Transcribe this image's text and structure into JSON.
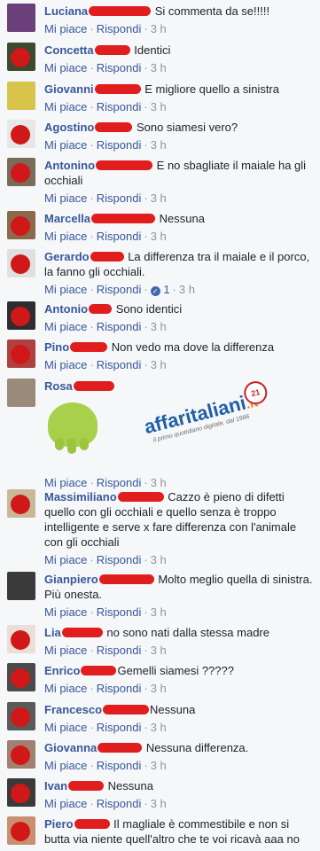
{
  "actions": {
    "like": "Mi piace",
    "reply": "Rispondi",
    "separator": "·"
  },
  "watermark": {
    "brand": "affaritaliani",
    "tld": ".it",
    "subtitle": "il primo quotidiano digitale, dal 1996",
    "badge": "21"
  },
  "comments": [
    {
      "name": "Luciana",
      "text": "Si commenta da se!!!!!",
      "time": "3 h"
    },
    {
      "name": "Concetta",
      "text": "Identici",
      "time": "3 h"
    },
    {
      "name": "Giovanni",
      "text": "E migliore quello a sinistra",
      "time": "3 h"
    },
    {
      "name": "Agostino",
      "text": "Sono siamesi vero?",
      "time": "3 h"
    },
    {
      "name": "Antonino",
      "text": "E no sbagliate il maiale ha gli occhiali",
      "time": "3 h"
    },
    {
      "name": "Marcella",
      "text": "Nessuna",
      "time": "3 h"
    },
    {
      "name": "Gerardo",
      "text": "La differenza tra il maiale e il porco, la fanno gli occhiali.",
      "time": "3 h",
      "likes": "1"
    },
    {
      "name": "Antonio",
      "text": "Sono identici",
      "time": "3 h"
    },
    {
      "name": "Pino",
      "text": "Non vedo ma dove la differenza",
      "time": "3 h"
    },
    {
      "name": "Rosa",
      "text": "",
      "time": "3 h"
    },
    {
      "name": "Massimiliano",
      "text": "Cazzo è pieno di difetti quello con gli occhiali e quello senza è troppo intelligente e serve x fare differenza con l'animale con gli occhiali",
      "time": "3 h"
    },
    {
      "name": "Gianpiero",
      "text": "Molto meglio quella di sinistra. Più onesta.",
      "time": "3 h"
    },
    {
      "name": "Lia",
      "text": "no sono nati dalla stessa madre",
      "time": "3 h"
    },
    {
      "name": "Enrico",
      "text": "Gemelli siamesi ?????",
      "time": "3 h"
    },
    {
      "name": "Francesco",
      "text": "Nessuna",
      "time": "3 h"
    },
    {
      "name": "Giovanna",
      "text": "Nessuna differenza.",
      "time": "3 h"
    },
    {
      "name": "Ivan",
      "text": "Nessuna",
      "time": "3 h"
    },
    {
      "name": "Piero",
      "text": "Il magliale è commestibile e non si butta via niente quell'altro che te voi ricavà aaa no",
      "time": ""
    }
  ]
}
